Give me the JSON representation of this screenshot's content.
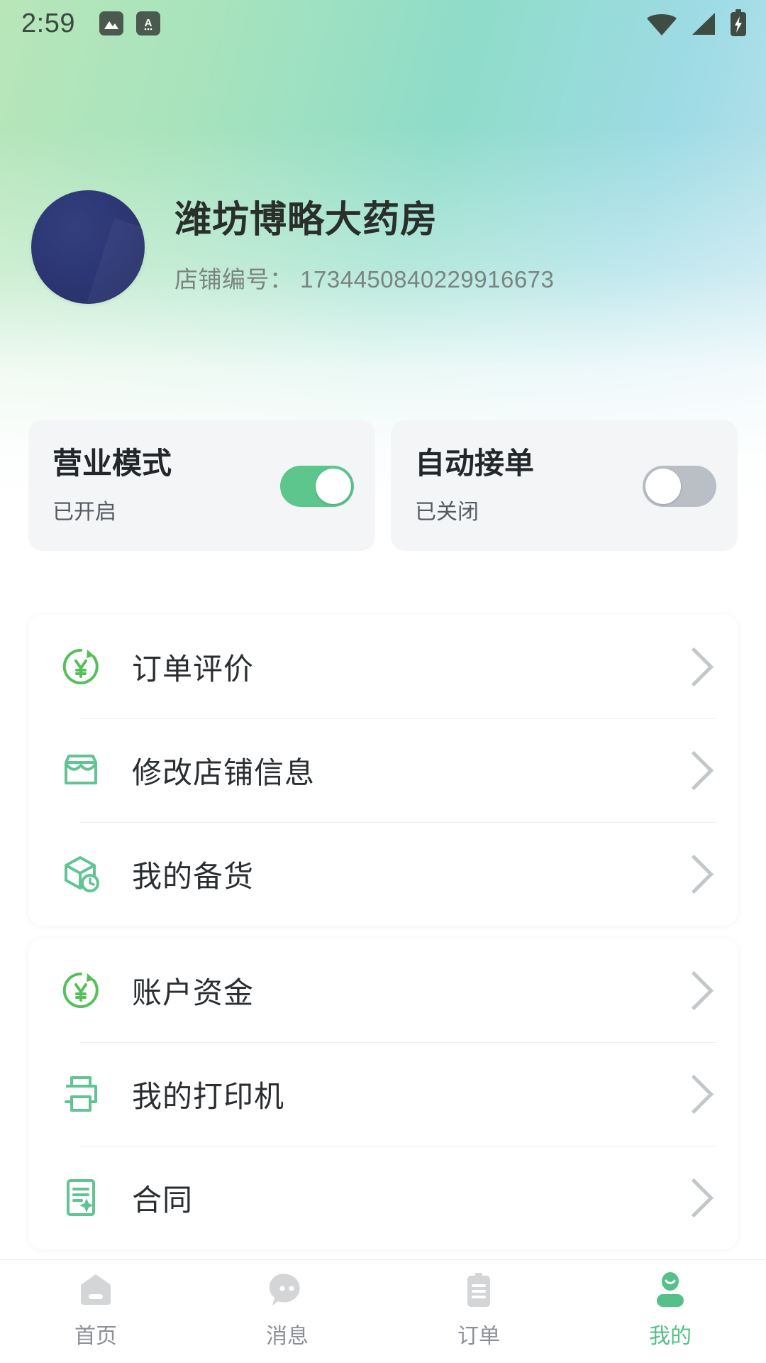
{
  "status_bar": {
    "time": "2:59",
    "left_icons": [
      "image-icon",
      "app-badge-icon"
    ],
    "right_icons": [
      "wifi-icon",
      "cellular-signal-icon",
      "battery-charging-icon"
    ]
  },
  "profile": {
    "avatar": "shop-avatar",
    "shop_name": "潍坊博略大药房",
    "shop_id_label": "店铺编号：",
    "shop_id_value": "1734450840229916673",
    "shop_id_full": "店铺编号： 1734450840229916673"
  },
  "toggles": [
    {
      "title": "营业模式",
      "status": "已开启",
      "state": "on",
      "icon": "toggle-switch-on"
    },
    {
      "title": "自动接单",
      "status": "已关闭",
      "state": "off",
      "icon": "toggle-switch-off"
    }
  ],
  "menu_groups": [
    {
      "items": [
        {
          "label": "订单评价",
          "icon": "yuan-refresh-icon"
        },
        {
          "label": "修改店铺信息",
          "icon": "storefront-icon"
        },
        {
          "label": "我的备货",
          "icon": "box-clock-icon"
        }
      ]
    },
    {
      "items": [
        {
          "label": "账户资金",
          "icon": "yuan-refresh-icon"
        },
        {
          "label": "我的打印机",
          "icon": "printer-icon"
        },
        {
          "label": "合同",
          "icon": "contract-star-icon"
        }
      ]
    }
  ],
  "bottom_nav": {
    "items": [
      {
        "label": "首页",
        "icon": "home-icon",
        "active": false
      },
      {
        "label": "消息",
        "icon": "chat-bubble-icon",
        "active": false
      },
      {
        "label": "订单",
        "icon": "clipboard-icon",
        "active": false
      },
      {
        "label": "我的",
        "icon": "person-icon",
        "active": true
      }
    ]
  },
  "colors": {
    "accent_green": "#55c08a",
    "switch_on": "#5cc68c",
    "switch_off": "#b9bfc5",
    "icon_green": "#5fc77f",
    "icon_green_soft": "#6cc79a",
    "text_primary": "#2a2e31",
    "text_muted": "#8b9096",
    "card_bg": "#f3f5f7",
    "gradient_start": "#b8e6b9",
    "gradient_end": "#d4ecf5",
    "avatar": "#2c3775"
  }
}
